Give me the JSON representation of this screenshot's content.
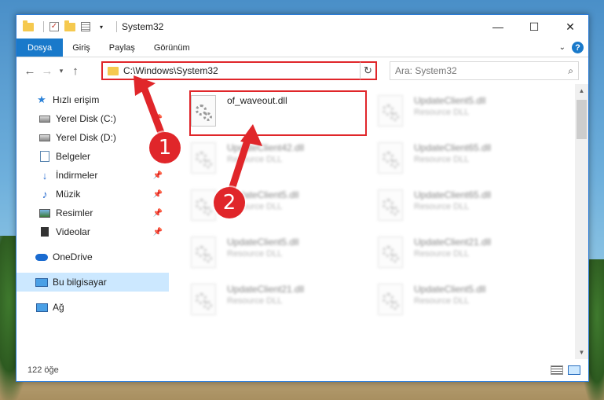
{
  "window": {
    "title": "System32",
    "controls": {
      "minimize": "—",
      "maximize": "☐",
      "close": "✕"
    }
  },
  "ribbon": {
    "file_tab": "Dosya",
    "tabs": [
      "Giriş",
      "Paylaş",
      "Görünüm"
    ],
    "help": "?"
  },
  "navbar": {
    "address": "C:\\Windows\\System32",
    "search_placeholder": "Ara: System32"
  },
  "sidebar": {
    "quick_access": "Hızlı erişim",
    "items": [
      {
        "label": "Yerel Disk (C:)",
        "pinned": true
      },
      {
        "label": "Yerel Disk (D:)",
        "pinned": false
      },
      {
        "label": "Belgeler",
        "pinned": false
      },
      {
        "label": "İndirmeler",
        "pinned": true
      },
      {
        "label": "Müzik",
        "pinned": true
      },
      {
        "label": "Resimler",
        "pinned": true
      },
      {
        "label": "Videolar",
        "pinned": true
      }
    ],
    "onedrive": "OneDrive",
    "this_pc": "Bu bilgisayar",
    "network": "Ağ"
  },
  "files": {
    "main": {
      "name": "of_waveout.dll",
      "type": ""
    },
    "blurred_left": [
      {
        "name": "UpdateClient42.dll",
        "type": "Resource DLL"
      },
      {
        "name": "UpdateClient5.dll",
        "type": "Resource DLL"
      },
      {
        "name": "UpdateClient5.dll",
        "type": "Resource DLL"
      },
      {
        "name": "UpdateClient21.dll",
        "type": "Resource DLL"
      }
    ],
    "blurred_right": [
      {
        "name": "UpdateClient5.dll",
        "type": "Resource DLL"
      },
      {
        "name": "UpdateClient65.dll",
        "type": "Resource DLL"
      },
      {
        "name": "UpdateClient65.dll",
        "type": "Resource DLL"
      },
      {
        "name": "UpdateClient21.dll",
        "type": "Resource DLL"
      },
      {
        "name": "UpdateClient5.dll",
        "type": "Resource DLL"
      }
    ]
  },
  "status": {
    "item_count": "122 öğe"
  },
  "annotations": {
    "step1": "1",
    "step2": "2",
    "color": "#e0262a"
  }
}
